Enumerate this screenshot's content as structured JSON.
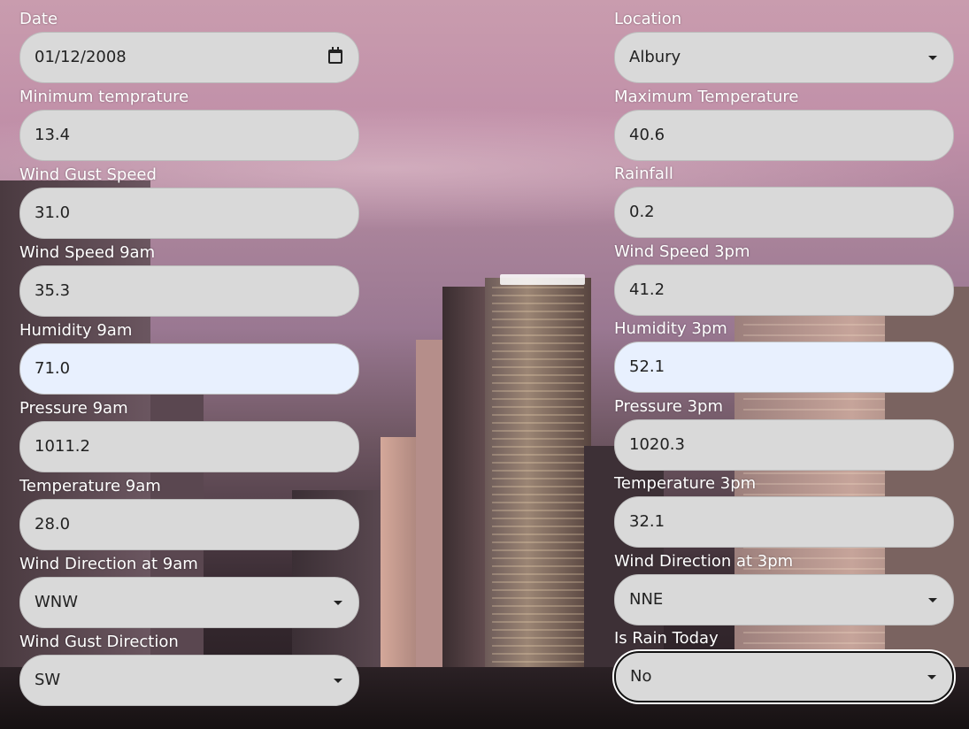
{
  "form": {
    "left": [
      {
        "label": "Date",
        "value": "01/12/2008",
        "kind": "date"
      },
      {
        "label": "Minimum temprature",
        "value": "13.4",
        "kind": "number"
      },
      {
        "label": "Wind Gust Speed",
        "value": "31.0",
        "kind": "number"
      },
      {
        "label": "Wind Speed 9am",
        "value": "35.3",
        "kind": "number"
      },
      {
        "label": "Humidity 9am",
        "value": "71.0",
        "kind": "number",
        "autofill": true
      },
      {
        "label": "Pressure 9am",
        "value": "1011.2",
        "kind": "number"
      },
      {
        "label": "Temperature 9am",
        "value": "28.0",
        "kind": "number"
      },
      {
        "label": "Wind Direction at 9am",
        "value": "WNW",
        "kind": "select"
      },
      {
        "label": "Wind Gust Direction",
        "value": "SW",
        "kind": "select"
      }
    ],
    "right": [
      {
        "label": "Location",
        "value": "Albury",
        "kind": "select"
      },
      {
        "label": "Maximum Temperature",
        "value": "40.6",
        "kind": "number"
      },
      {
        "label": "Rainfall",
        "value": "0.2",
        "kind": "number"
      },
      {
        "label": "Wind Speed 3pm",
        "value": "41.2",
        "kind": "number"
      },
      {
        "label": "Humidity 3pm",
        "value": "52.1",
        "kind": "number",
        "autofill": true
      },
      {
        "label": "Pressure 3pm",
        "value": "1020.3",
        "kind": "number"
      },
      {
        "label": "Temperature 3pm",
        "value": "32.1",
        "kind": "number"
      },
      {
        "label": "Wind Direction at 3pm",
        "value": "NNE",
        "kind": "select"
      },
      {
        "label": "Is Rain Today",
        "value": "No",
        "kind": "select",
        "focused": true
      }
    ]
  },
  "colors": {
    "field_bg": "#d9d9d9",
    "autofill_bg": "#e8f0fe",
    "label_text": "#ffffff"
  },
  "icons": {
    "date": "calendar-icon",
    "select": "chevron-down-icon"
  }
}
